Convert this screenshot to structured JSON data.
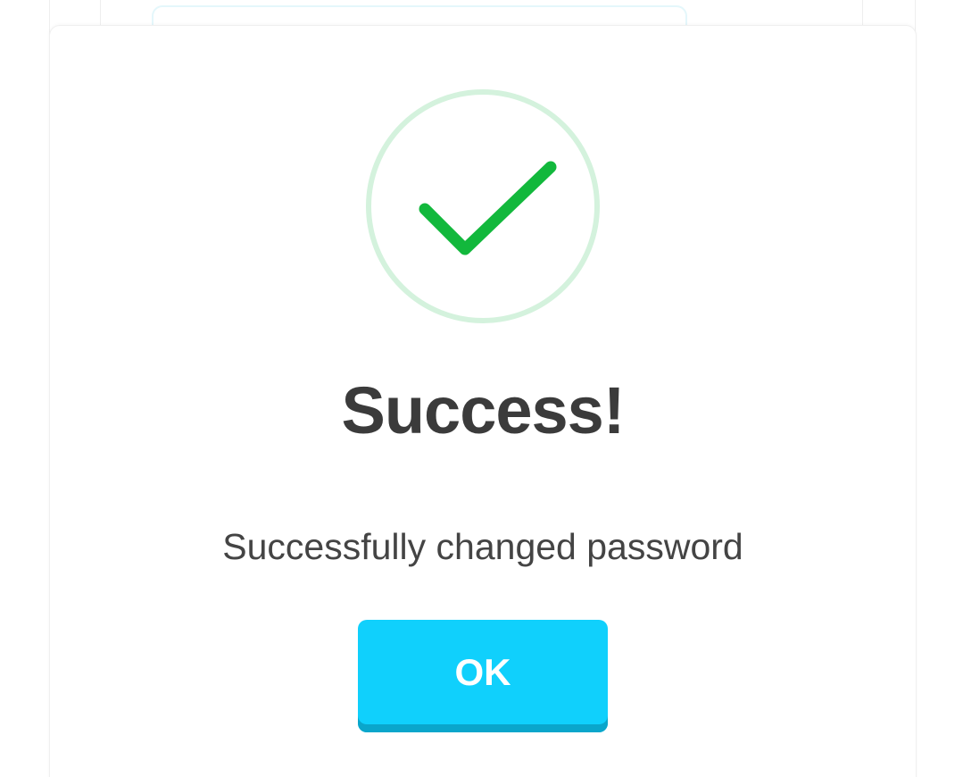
{
  "modal": {
    "icon": "success-check-icon",
    "title": "Success!",
    "message": "Successfully changed password",
    "ok_label": "OK"
  },
  "colors": {
    "check": "#12b83c",
    "ring": "#d4f2dd",
    "button": "#10d0fc",
    "button_shadow": "#0aa6cb",
    "title_text": "#3b3b3b"
  }
}
